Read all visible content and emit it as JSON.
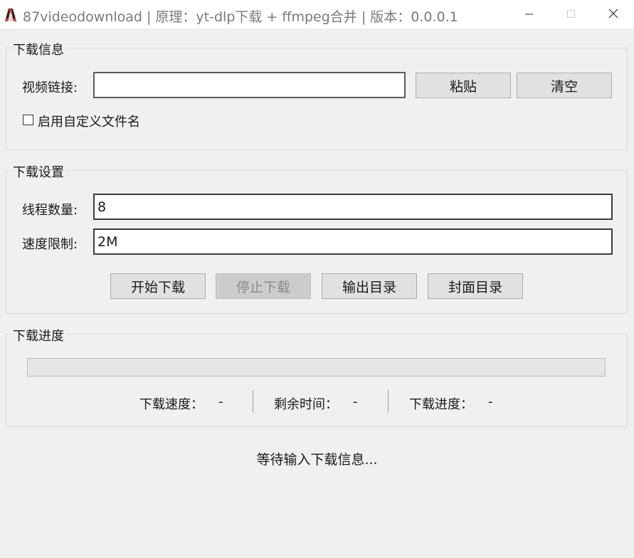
{
  "window": {
    "title": "87videodownload | 原理：yt-dlp下载 + ffmpeg合并 | 版本：0.0.0.1",
    "controls": [
      "minimize-icon",
      "maximize-icon",
      "close-icon"
    ]
  },
  "download_info": {
    "group_title": "下载信息",
    "url_label": "视频链接:",
    "url_value": "",
    "paste_label": "粘贴",
    "clear_label": "清空",
    "custom_filename_label": "启用自定义文件名",
    "custom_filename_checked": false
  },
  "download_settings": {
    "group_title": "下载设置",
    "threads_label": "线程数量:",
    "threads_value": "8",
    "speed_label": "速度限制:",
    "speed_value": "2M",
    "buttons": {
      "start": "开始下载",
      "stop": "停止下载",
      "output_dir": "输出目录",
      "cover_dir": "封面目录"
    },
    "stop_disabled": true
  },
  "progress": {
    "group_title": "下载进度",
    "percent": 0,
    "speed_label": "下载速度：",
    "speed_value": "-",
    "remaining_label": "剩余时间：",
    "remaining_value": "-",
    "progress_label": "下载进度：",
    "progress_value": "-"
  },
  "status_text": "等待输入下载信息...",
  "colors": {
    "background": "#f0f0f0",
    "titlebar": "#ffffff",
    "button": "#e1e1e1",
    "button_disabled": "#cccccc",
    "progress_fill": "#06b025"
  }
}
